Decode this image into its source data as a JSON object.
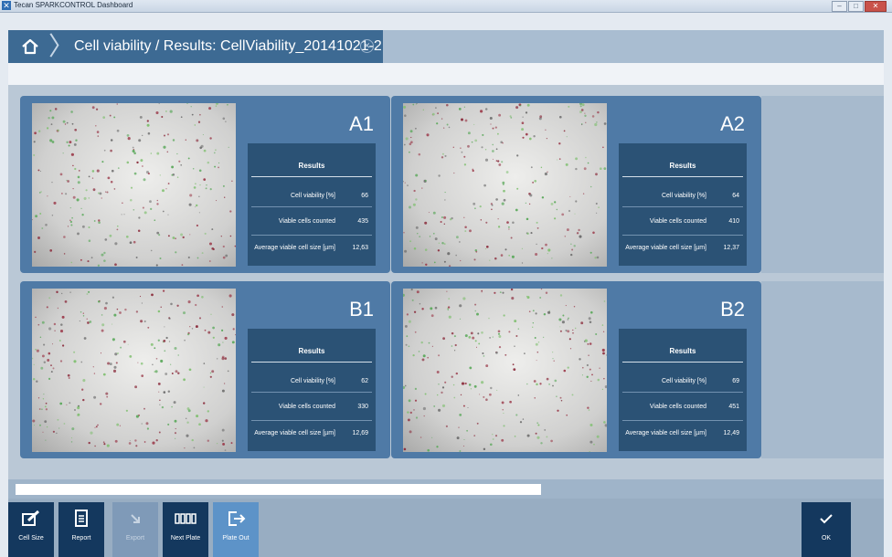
{
  "window": {
    "title": "Tecan SPARKCONTROL Dashboard"
  },
  "header": {
    "breadcrumb": "Cell viability / Results: CellViability_20141021-2"
  },
  "wells": [
    {
      "name": "A1",
      "results_title": "Results",
      "metrics": [
        {
          "label": "Cell viability [%]",
          "value": "66"
        },
        {
          "label": "Viable cells counted",
          "value": "435"
        },
        {
          "label": "Average viable cell size [µm]",
          "value": "12,63"
        }
      ]
    },
    {
      "name": "A2",
      "results_title": "Results",
      "metrics": [
        {
          "label": "Cell viability [%]",
          "value": "64"
        },
        {
          "label": "Viable cells counted",
          "value": "410"
        },
        {
          "label": "Average viable cell size [µm]",
          "value": "12,37"
        }
      ]
    },
    {
      "name": "B1",
      "results_title": "Results",
      "metrics": [
        {
          "label": "Cell viability [%]",
          "value": "62"
        },
        {
          "label": "Viable cells counted",
          "value": "330"
        },
        {
          "label": "Average viable cell size [µm]",
          "value": "12,69"
        }
      ]
    },
    {
      "name": "B2",
      "results_title": "Results",
      "metrics": [
        {
          "label": "Cell viability [%]",
          "value": "69"
        },
        {
          "label": "Viable cells counted",
          "value": "451"
        },
        {
          "label": "Average viable cell size [µm]",
          "value": "12,49"
        }
      ]
    }
  ],
  "progress": {
    "fraction": 0.61
  },
  "toolbar": {
    "cell_size": "Cell Size",
    "report": "Report",
    "export": "Export",
    "next_plate": "Next Plate",
    "plate_out": "Plate Out",
    "ok": "OK"
  },
  "colors": {
    "header": "#3d6a93",
    "well_panel": "#4f7aa6",
    "results_panel": "#2b5275",
    "toolbar_dark": "#14385e"
  }
}
